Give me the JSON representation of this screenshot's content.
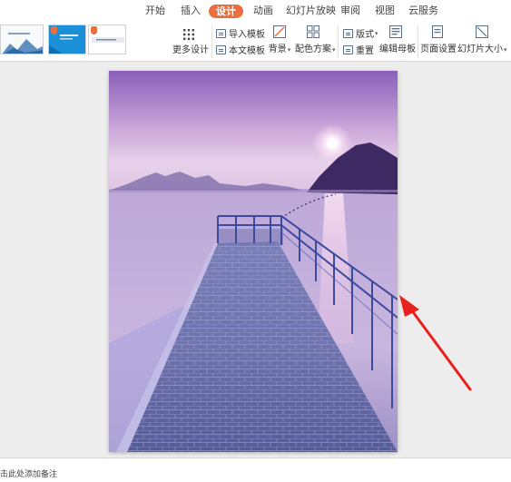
{
  "menu": {
    "items": [
      "开始",
      "插入",
      "设计",
      "动画",
      "幻灯片放映",
      "审阅",
      "视图",
      "云服务"
    ],
    "active": "设计"
  },
  "ribbon": {
    "more_design": "更多设计",
    "import_template": "导入模板",
    "text_template": "本文模板",
    "background": "背景",
    "color_scheme": "配色方案",
    "layout": "版式",
    "reset": "重置",
    "edit_master": "编辑母板",
    "page_setup": "页面设置",
    "slide_size": "幻灯片大小"
  },
  "notes": {
    "placeholder": "击此处添加备注"
  },
  "colors": {
    "accent": "#e9703e",
    "arrow": "#e8201e"
  },
  "icons": [
    "grid-icon",
    "import-template-icon",
    "text-template-icon",
    "background-icon",
    "color-scheme-icon",
    "layout-icon",
    "reset-icon",
    "edit-master-icon",
    "page-setup-icon",
    "slide-size-icon"
  ]
}
